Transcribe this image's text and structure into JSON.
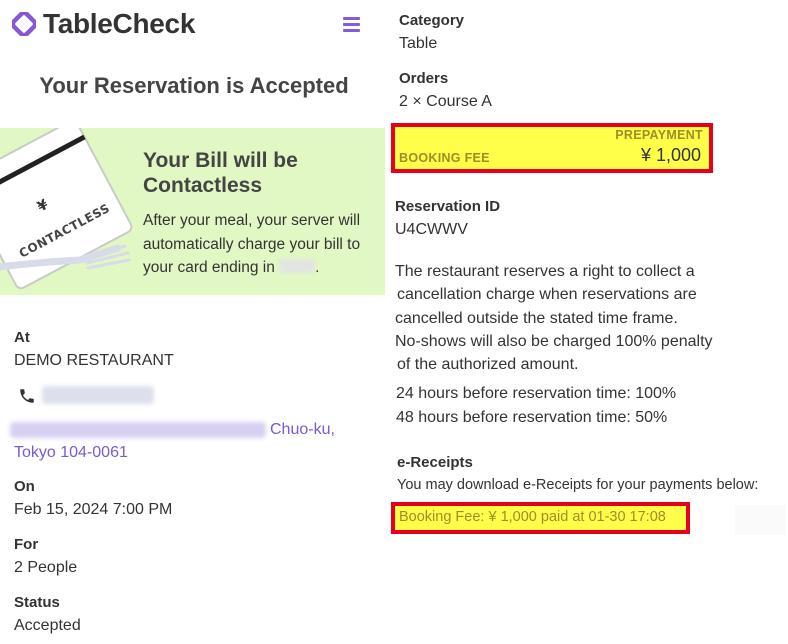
{
  "brand": {
    "name": "TableCheck",
    "accent": "#8a57d6"
  },
  "page": {
    "title": "Your Reservation is Accepted"
  },
  "banner": {
    "title": "Your Bill will be Contactless",
    "text_before": "After your meal, your server will automatically charge your bill to your card ending in",
    "text_after": ".",
    "card_text": "CONTACTLESS",
    "card_symbol": "¥"
  },
  "details": {
    "at_label": "At",
    "restaurant": "DEMO RESTAURANT",
    "address_link_1": "Chuo-ku,",
    "address_link_2": "Tokyo 104-0061",
    "on_label": "On",
    "datetime": "Feb 15, 2024 7:00 PM",
    "for_label": "For",
    "party": "2 People",
    "status_label": "Status",
    "status": "Accepted"
  },
  "order": {
    "category_label": "Category",
    "category": "Table",
    "orders_label": "Orders",
    "orders": "2 × Course A"
  },
  "prepayment": {
    "label": "PREPAYMENT",
    "fee_label": "BOOKING FEE",
    "amount": "¥ 1,000"
  },
  "reservation": {
    "id_label": "Reservation ID",
    "id": "U4CWWV"
  },
  "policy": {
    "lines": [
      "The restaurant reserves a right to collect a",
      "cancellation charge when reservations are",
      "cancelled outside the stated time frame.",
      "No-shows will also be charged 100% penalty",
      "of the authorized amount."
    ],
    "rule_24h": "24 hours before reservation time: 100%",
    "rule_48h": "48 hours before reservation time: 50%"
  },
  "receipts": {
    "label": "e-Receipts",
    "intro": "You may download e-Receipts for your payments below:",
    "link": "Booking Fee: ¥ 1,000 paid at 01-30 17:08"
  },
  "icons": {
    "logo": "tablecheck-logo-icon",
    "menu": "hamburger-menu-icon",
    "phone": "phone-icon"
  },
  "colors": {
    "highlight": "#ffff4a",
    "highlight_border": "#e8001a",
    "banner_bg": "#e1f7c4",
    "link": "#7b59d0"
  }
}
